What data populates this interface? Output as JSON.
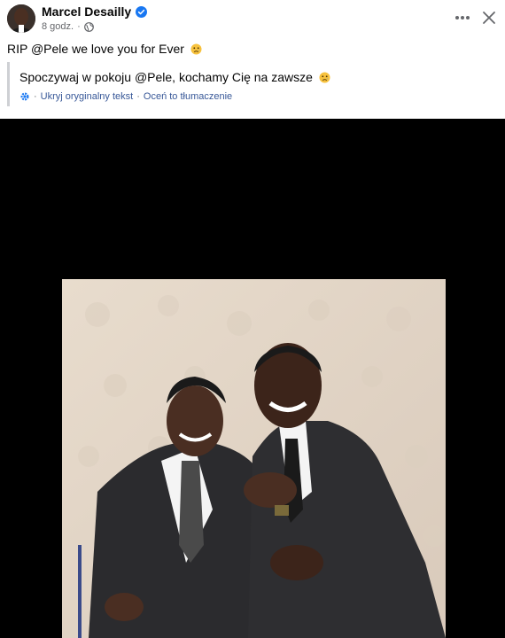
{
  "post": {
    "author": "Marcel Desailly",
    "timestamp": "8 godz.",
    "separator": "·",
    "text": "RIP @Pele we love you for Ever",
    "text_emoji": "sad-face",
    "verified": true
  },
  "translation": {
    "text": "Spoczywaj w pokoju @Pele, kochamy Cię na zawsze",
    "hide_original_label": "Ukryj oryginalny tekst",
    "rate_label": "Oceń to tłumaczenie",
    "separator": "·"
  },
  "icons": {
    "verified": "verified-badge-icon",
    "privacy": "globe-icon",
    "more": "more-options-icon",
    "close": "close-icon",
    "translate": "translate-gear-icon"
  },
  "colors": {
    "text_primary": "#050505",
    "text_secondary": "#65676b",
    "link": "#385898",
    "verified_blue": "#1877f2",
    "media_background": "#000000"
  }
}
